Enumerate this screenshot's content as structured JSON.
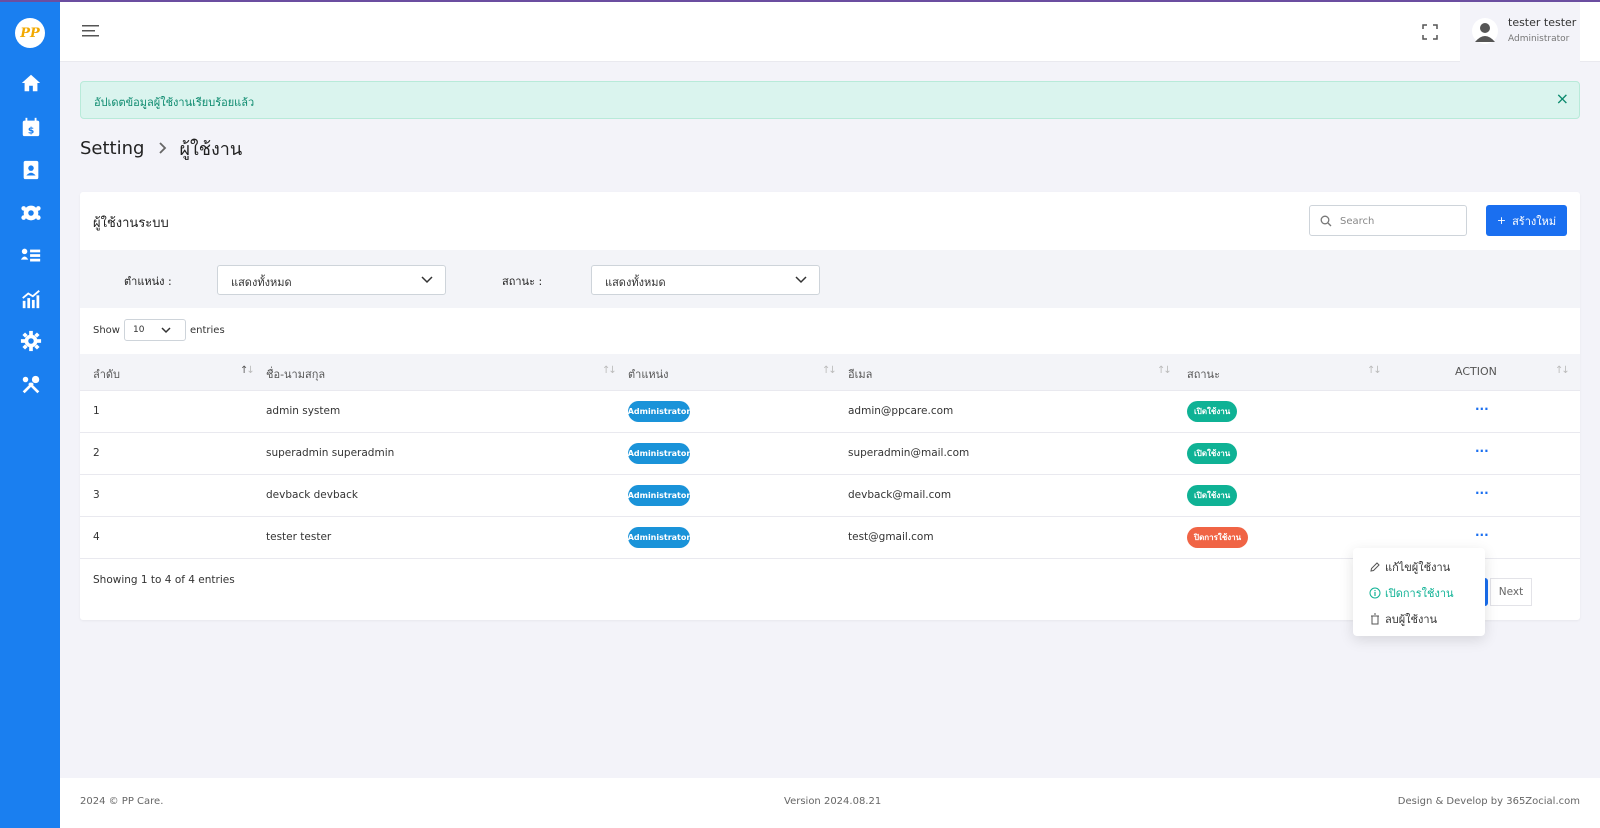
{
  "app": {
    "logo_text": "PP"
  },
  "sidebar": {
    "items": [
      {
        "name": "home",
        "icon": "home-icon"
      },
      {
        "name": "billing",
        "icon": "calendar-dollar-icon"
      },
      {
        "name": "contacts",
        "icon": "contact-book-icon"
      },
      {
        "name": "team-settings",
        "icon": "users-gear-icon"
      },
      {
        "name": "list",
        "icon": "user-list-icon"
      },
      {
        "name": "reports",
        "icon": "chart-icon"
      },
      {
        "name": "settings",
        "icon": "gear-icon"
      },
      {
        "name": "tools",
        "icon": "tools-icon"
      }
    ]
  },
  "header": {
    "user_name": "tester tester",
    "user_role": "Administrator"
  },
  "alert": {
    "message": "อัปเดตข้อมูลผู้ใช้งานเรียบร้อยแล้ว",
    "close": "×"
  },
  "breadcrumb": {
    "parent": "Setting",
    "current": "ผู้ใช้งาน"
  },
  "card": {
    "title": "ผู้ใช้งานระบบ",
    "search_placeholder": "Search",
    "create_label": "สร้างใหม่"
  },
  "filters": {
    "position_label": "ตำแหน่ง :",
    "position_value": "แสดงทั้งหมด",
    "status_label": "สถานะ :",
    "status_value": "แสดงทั้งหมด"
  },
  "length": {
    "show": "Show",
    "value": "10",
    "entries": "entries"
  },
  "table": {
    "columns": [
      "ลำดับ",
      "ชื่อ-นามสกุล",
      "ตำแหน่ง",
      "อีเมล",
      "สถานะ",
      "ACTION"
    ],
    "rows": [
      {
        "no": "1",
        "name": "admin system",
        "role": "Administrator",
        "email": "admin@ppcare.com",
        "status": "เปิดใช้งาน",
        "active": true
      },
      {
        "no": "2",
        "name": "superadmin superadmin",
        "role": "Administrator",
        "email": "superadmin@mail.com",
        "status": "เปิดใช้งาน",
        "active": true
      },
      {
        "no": "3",
        "name": "devback devback",
        "role": "Administrator",
        "email": "devback@mail.com",
        "status": "เปิดใช้งาน",
        "active": true
      },
      {
        "no": "4",
        "name": "tester tester",
        "role": "Administrator",
        "email": "test@gmail.com",
        "status": "ปิดการใช้งาน",
        "active": false
      }
    ],
    "action_label": "···"
  },
  "info": "Showing 1 to 4 of 4 entries",
  "pagination": {
    "current": "1",
    "next": "Next"
  },
  "dropdown": {
    "edit": "แก้ไขผู้ใช้งาน",
    "enable": "เปิดการใช้งาน",
    "delete": "ลบผู้ใช้งาน"
  },
  "footer": {
    "copyright": "2024 © PP Care.",
    "version": "Version 2024.08.21",
    "credit": "Design & Develop by 365Zocial.com"
  },
  "colors": {
    "sidebar": "#1a7ff0",
    "primary": "#1a6ff0",
    "success": "#0fb295",
    "danger": "#f06445",
    "role_badge": "#1a93d9"
  }
}
